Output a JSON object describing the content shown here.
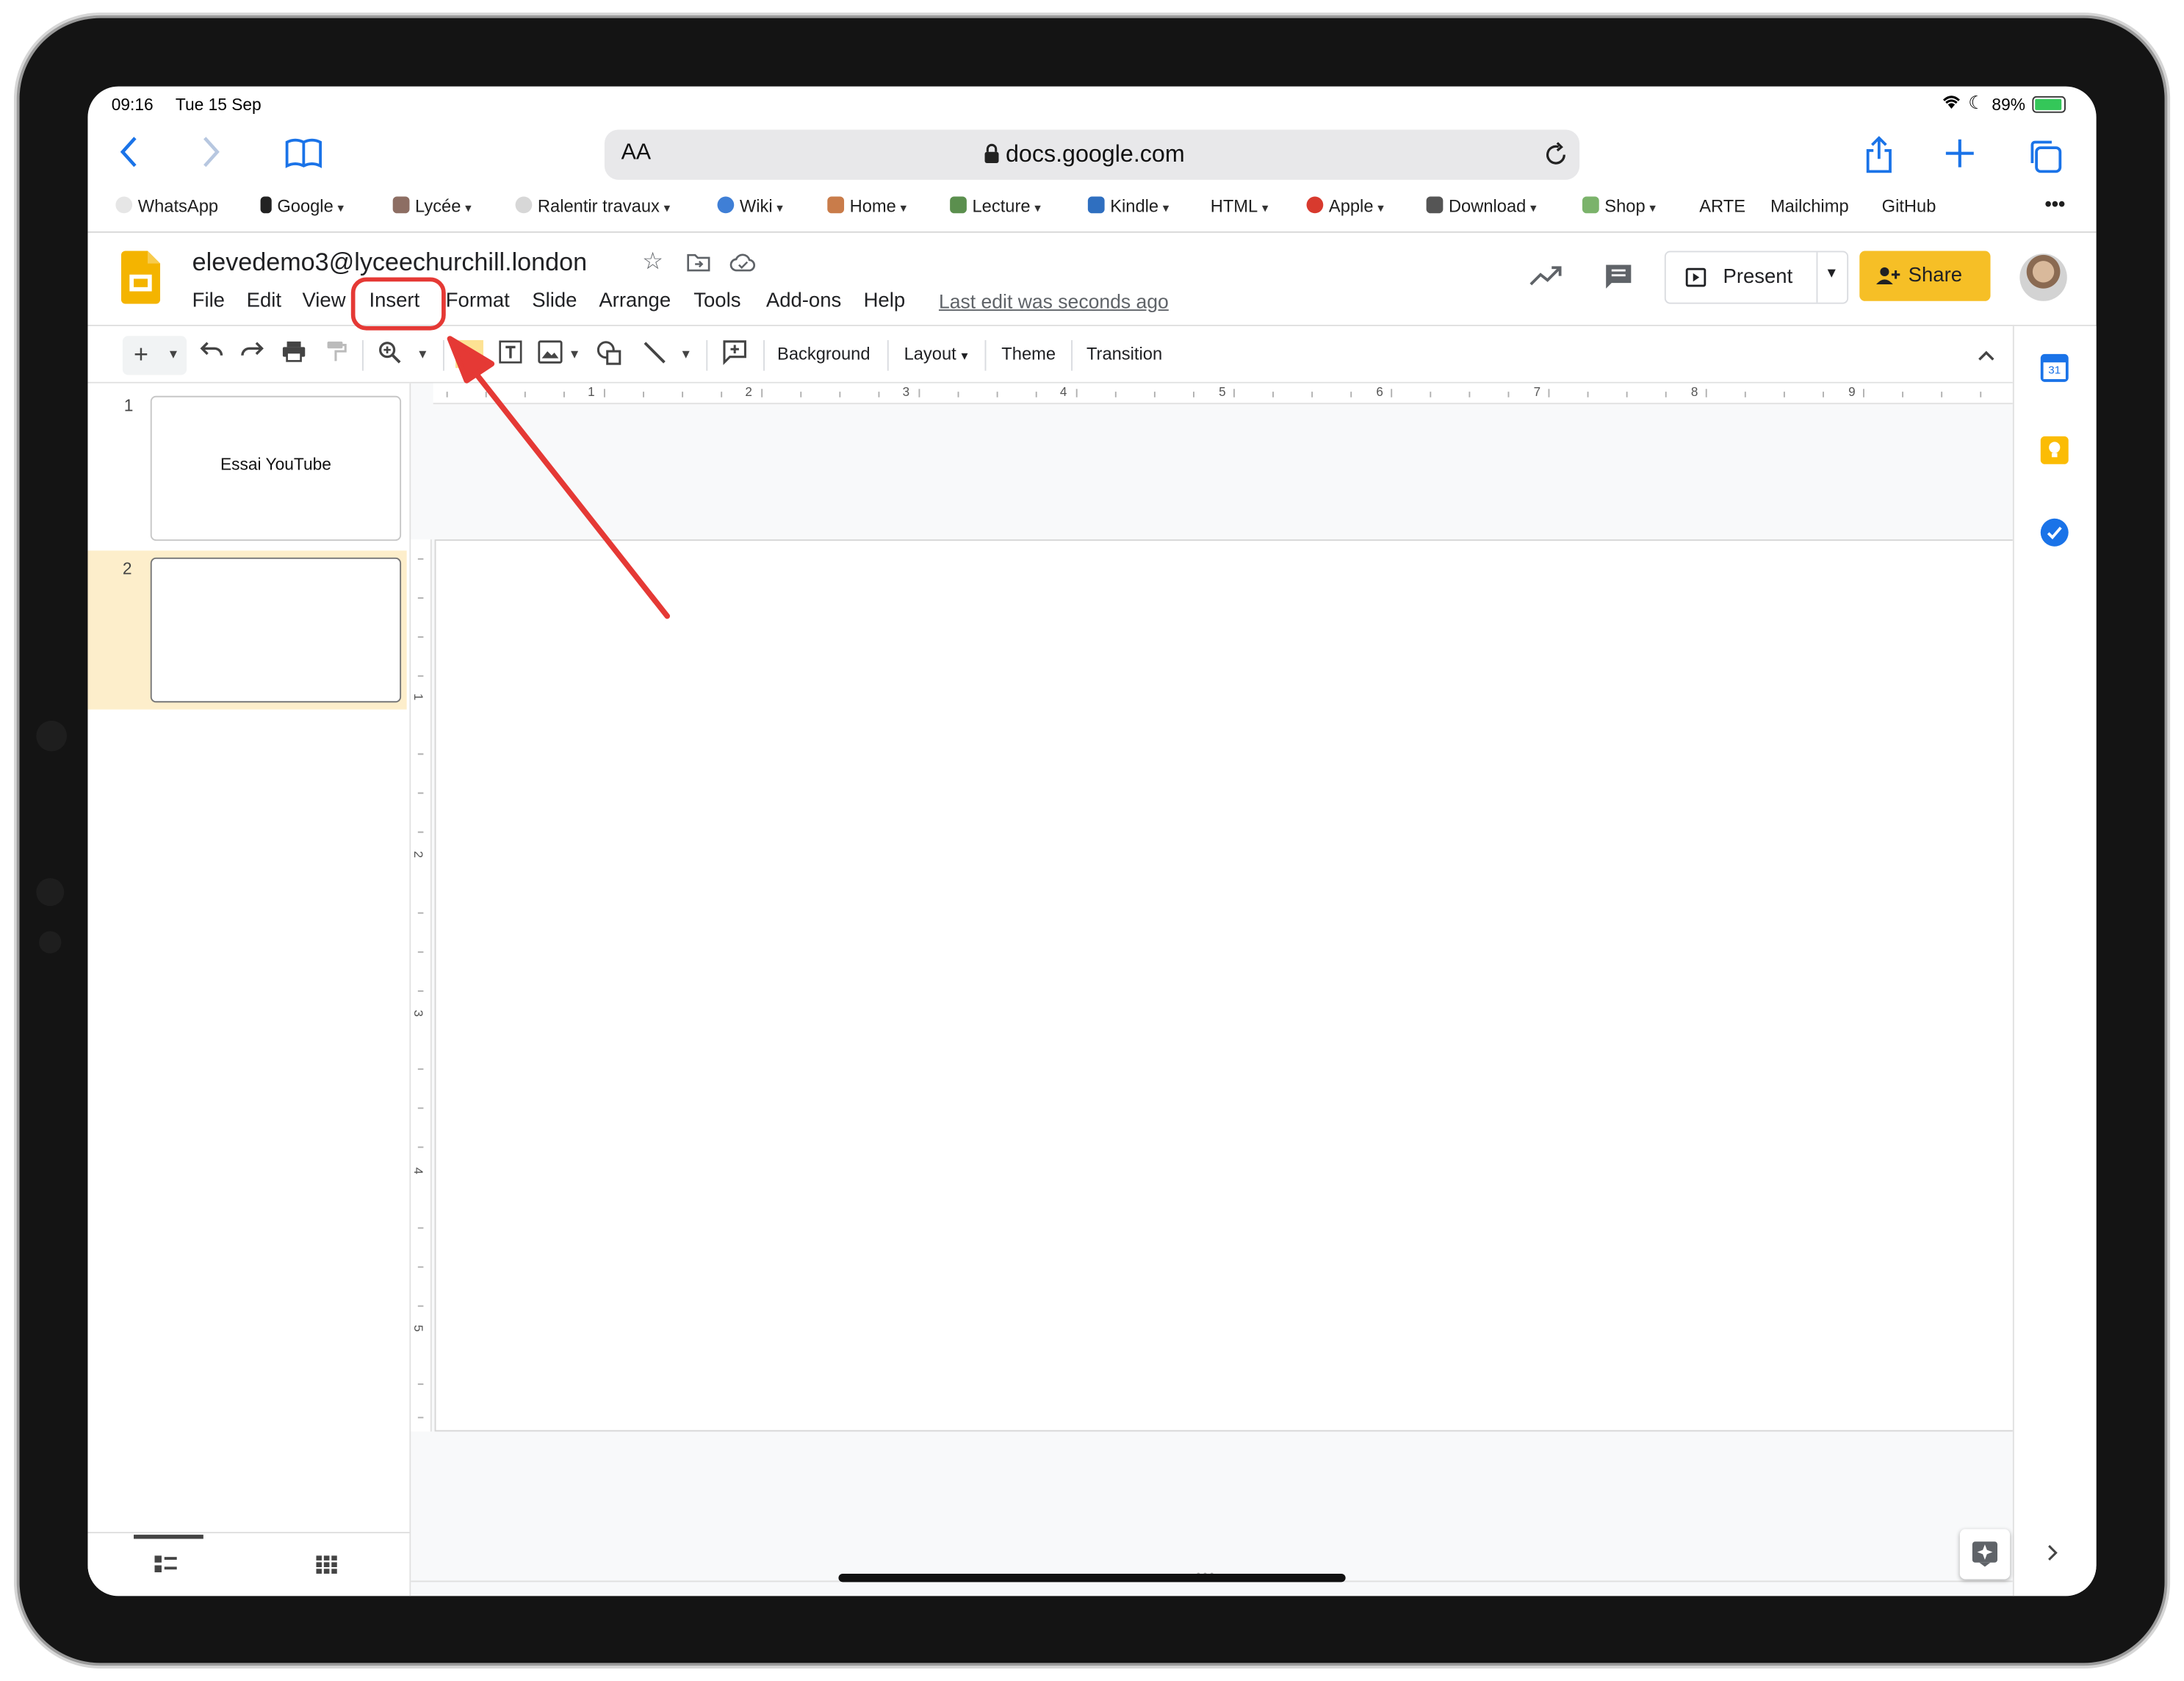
{
  "status_bar": {
    "time": "09:16",
    "date": "Tue 15 Sep",
    "battery": "89%"
  },
  "safari": {
    "text_size_label": "AA",
    "url": "docs.google.com",
    "bookmarks": [
      {
        "label": "WhatsApp",
        "has_menu": false
      },
      {
        "label": "Google",
        "has_menu": true
      },
      {
        "label": "Lycée",
        "has_menu": true
      },
      {
        "label": "Ralentir travaux",
        "has_menu": true
      },
      {
        "label": "Wiki",
        "has_menu": true
      },
      {
        "label": "Home",
        "has_menu": true
      },
      {
        "label": "Lecture",
        "has_menu": true
      },
      {
        "label": "Kindle",
        "has_menu": true
      },
      {
        "label": "HTML",
        "has_menu": true
      },
      {
        "label": "Apple",
        "has_menu": true
      },
      {
        "label": "Download",
        "has_menu": true
      },
      {
        "label": "Shop",
        "has_menu": true
      },
      {
        "label": "ARTE",
        "has_menu": false
      },
      {
        "label": "Mailchimp",
        "has_menu": false
      },
      {
        "label": "GitHub",
        "has_menu": false
      }
    ],
    "more_label": "•••"
  },
  "slides": {
    "doc_title": "elevedemo3@lyceechurchill.london",
    "menu": [
      "File",
      "Edit",
      "View",
      "Insert",
      "Format",
      "Slide",
      "Arrange",
      "Tools",
      "Add-ons",
      "Help"
    ],
    "last_edit": "Last edit was seconds ago",
    "present_label": "Present",
    "share_label": "Share",
    "toolbar": {
      "background": "Background",
      "layout": "Layout",
      "theme": "Theme",
      "transition": "Transition"
    },
    "ruler_h": [
      "1",
      "2",
      "3",
      "4",
      "5",
      "6",
      "7",
      "8",
      "9"
    ],
    "ruler_v": [
      "1",
      "2",
      "3",
      "4",
      "5"
    ],
    "thumbnails": [
      {
        "number": "1",
        "text": "Essai YouTube",
        "selected": false
      },
      {
        "number": "2",
        "text": "",
        "selected": true
      }
    ],
    "calendar_day": "31",
    "highlight": {
      "target": "Insert",
      "color": "#e53935"
    }
  }
}
